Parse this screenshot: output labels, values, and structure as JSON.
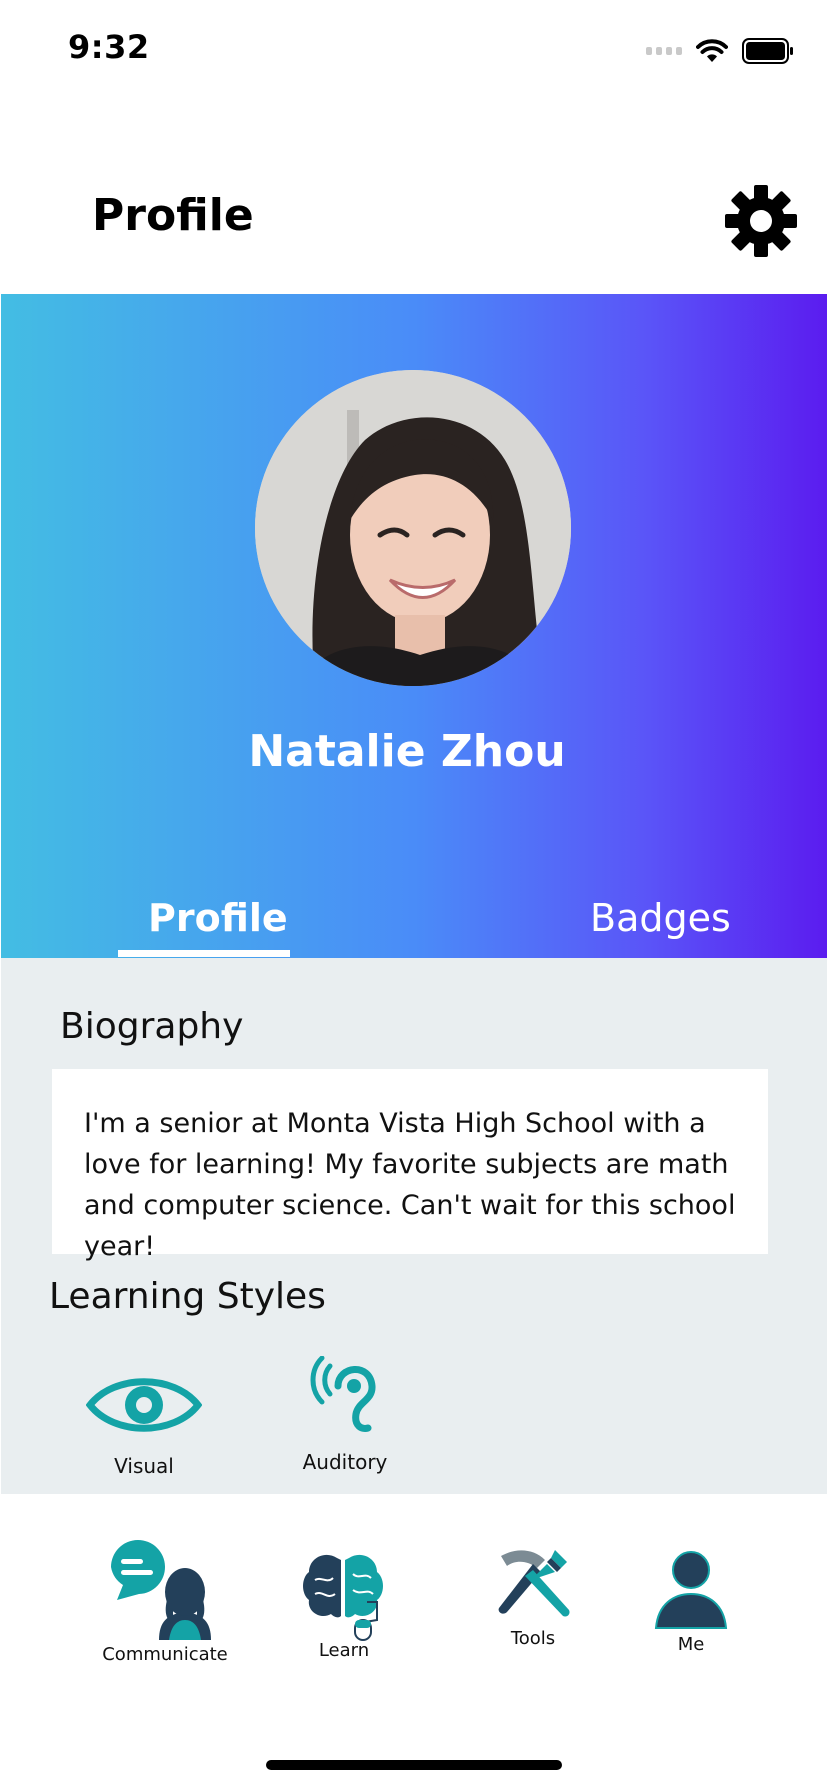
{
  "status_bar": {
    "time": "9:32"
  },
  "header": {
    "title": "Profile",
    "settings_icon": "gear-icon"
  },
  "profile": {
    "name": "Natalie Zhou",
    "avatar_icon": "user-photo"
  },
  "tabs": [
    {
      "label": "Profile",
      "active": true
    },
    {
      "label": "Badges",
      "active": false
    }
  ],
  "biography": {
    "title": "Biography",
    "text": "I'm a senior at Monta Vista High School with a love for learning! My favorite subjects are math and computer science. Can't wait for this school year!"
  },
  "learning_styles": {
    "title": "Learning Styles",
    "items": [
      {
        "label": "Visual",
        "icon": "eye-icon"
      },
      {
        "label": "Auditory",
        "icon": "ear-icon"
      }
    ]
  },
  "bottom_nav": [
    {
      "label": "Communicate",
      "icon": "communicate-icon"
    },
    {
      "label": "Learn",
      "icon": "brain-icon"
    },
    {
      "label": "Tools",
      "icon": "tools-icon"
    },
    {
      "label": "Me",
      "icon": "person-icon"
    }
  ],
  "colors": {
    "accent_teal": "#14a3a6",
    "navy": "#23405a",
    "gradient_start": "#43bde3",
    "gradient_end": "#5b1cef",
    "content_bg": "#e9eef0"
  }
}
